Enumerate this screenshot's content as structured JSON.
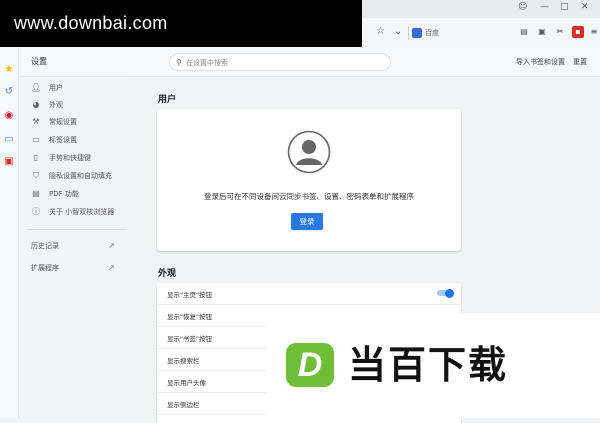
{
  "watermark_top": "www.downbai.com",
  "browser": {
    "search_engine_label": "百度",
    "window_controls": [
      "☺",
      "—",
      "□",
      "✕"
    ]
  },
  "page": {
    "title": "设置",
    "search_placeholder": "在设置中搜索",
    "import_link": "导入书签和设置",
    "reset_link": "重置"
  },
  "sidebar": {
    "items": [
      {
        "label": "用户",
        "icon": "person-icon"
      },
      {
        "label": "外观",
        "icon": "palette-icon"
      },
      {
        "label": "常规设置",
        "icon": "wrench-icon"
      },
      {
        "label": "标签设置",
        "icon": "tab-icon"
      },
      {
        "label": "手势和快捷键",
        "icon": "mouse-icon"
      },
      {
        "label": "隐私设置和自动填充",
        "icon": "shield-icon"
      },
      {
        "label": "PDF 功能",
        "icon": "pdf-icon"
      },
      {
        "label": "关于 小智双核浏览器",
        "icon": "info-icon"
      }
    ],
    "history": "历史记录",
    "extensions": "扩展程序"
  },
  "users_section": {
    "title": "用户",
    "prompt": "登录后可在不同设备间云同步书签、设置、密码表单和扩展程序",
    "login_button": "登录"
  },
  "appearance_section": {
    "title": "外观",
    "rows": [
      {
        "label": "显示\"主页\"按钮",
        "toggle_on": true
      },
      {
        "label": "显示\"恢复\"按钮"
      },
      {
        "label": "显示\"书签\"按钮"
      },
      {
        "label": "显示搜索栏"
      },
      {
        "label": "显示用户头像"
      },
      {
        "label": "显示侧边栏"
      }
    ]
  },
  "watermark_bottom": {
    "logo_letter": "D",
    "text": "当百下载"
  },
  "colors": {
    "accent": "#1a73e8",
    "logo_green": "#6fbe3a"
  }
}
